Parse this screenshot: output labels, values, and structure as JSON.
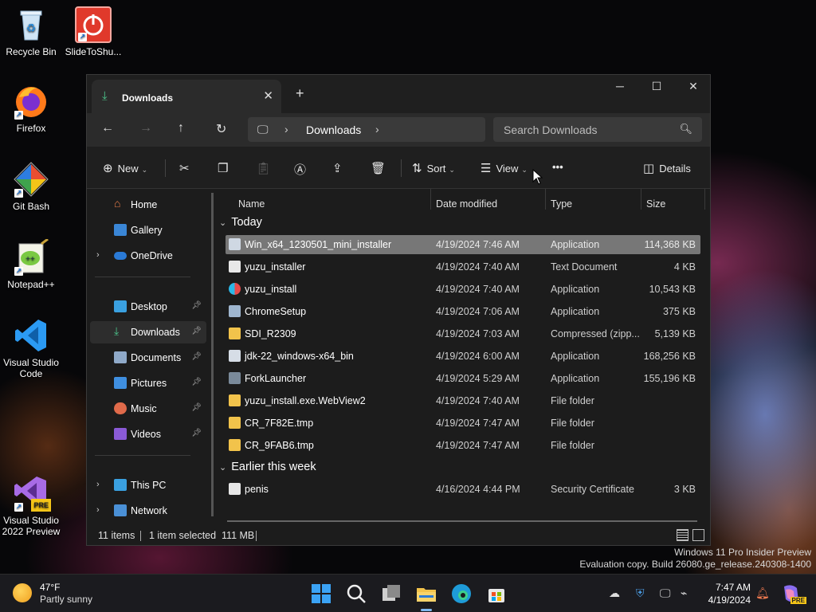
{
  "desktop": {
    "icons": [
      {
        "label": "Recycle Bin"
      },
      {
        "label": "SlideToShu..."
      },
      {
        "label": "Firefox"
      },
      {
        "label": "Git Bash"
      },
      {
        "label": "Notepad++"
      },
      {
        "label": "Visual Studio Code"
      },
      {
        "label": "Visual Studio 2022 Preview"
      }
    ]
  },
  "window": {
    "tab_title": "Downloads",
    "new_tab": "+",
    "controls": {
      "minimize": "─",
      "maximize": "☐",
      "close": "✕"
    },
    "address": {
      "crumb": "Downloads"
    },
    "search": {
      "placeholder": "Search Downloads"
    },
    "toolbar": {
      "new_label": "New",
      "sort_label": "Sort",
      "view_label": "View",
      "more_label": "•••",
      "details_label": "Details"
    },
    "sidebar": {
      "items": [
        {
          "label": "Home"
        },
        {
          "label": "Gallery"
        },
        {
          "label": "OneDrive"
        },
        {
          "label": "Desktop"
        },
        {
          "label": "Downloads"
        },
        {
          "label": "Documents"
        },
        {
          "label": "Pictures"
        },
        {
          "label": "Music"
        },
        {
          "label": "Videos"
        },
        {
          "label": "This PC"
        },
        {
          "label": "Network"
        }
      ]
    },
    "columns": {
      "name": "Name",
      "date": "Date modified",
      "type": "Type",
      "size": "Size"
    },
    "groups": [
      {
        "label": "Today",
        "files": [
          {
            "name": "Win_x64_1230501_mini_installer",
            "date": "4/19/2024 7:46 AM",
            "type": "Application",
            "size": "114,368 KB"
          },
          {
            "name": "yuzu_installer",
            "date": "4/19/2024 7:40 AM",
            "type": "Text Document",
            "size": "4 KB"
          },
          {
            "name": "yuzu_install",
            "date": "4/19/2024 7:40 AM",
            "type": "Application",
            "size": "10,543 KB"
          },
          {
            "name": "ChromeSetup",
            "date": "4/19/2024 7:06 AM",
            "type": "Application",
            "size": "375 KB"
          },
          {
            "name": "SDI_R2309",
            "date": "4/19/2024 7:03 AM",
            "type": "Compressed (zipp...",
            "size": "5,139 KB"
          },
          {
            "name": "jdk-22_windows-x64_bin",
            "date": "4/19/2024 6:00 AM",
            "type": "Application",
            "size": "168,256 KB"
          },
          {
            "name": "ForkLauncher",
            "date": "4/19/2024 5:29 AM",
            "type": "Application",
            "size": "155,196 KB"
          },
          {
            "name": "yuzu_install.exe.WebView2",
            "date": "4/19/2024 7:40 AM",
            "type": "File folder",
            "size": ""
          },
          {
            "name": "CR_7F82E.tmp",
            "date": "4/19/2024 7:47 AM",
            "type": "File folder",
            "size": ""
          },
          {
            "name": "CR_9FAB6.tmp",
            "date": "4/19/2024 7:47 AM",
            "type": "File folder",
            "size": ""
          }
        ]
      },
      {
        "label": "Earlier this week",
        "files": [
          {
            "name": "penis",
            "date": "4/16/2024 4:44 PM",
            "type": "Security Certificate",
            "size": "3 KB"
          }
        ]
      }
    ],
    "status": {
      "items": "11 items",
      "selected": "1 item selected  111 MB"
    }
  },
  "watermark": {
    "line1": "Windows 11 Pro Insider Preview",
    "line2": "Evaluation copy. Build 26080.ge_release.240308-1400"
  },
  "taskbar": {
    "weather_temp": "47°F",
    "weather_cond": "Partly sunny",
    "time": "7:47 AM",
    "date": "4/19/2024",
    "pre_badge": "PRE"
  },
  "colors": {
    "accent": "#4cc38a",
    "selected_row": "#777777",
    "folder": "#f2c34b"
  }
}
